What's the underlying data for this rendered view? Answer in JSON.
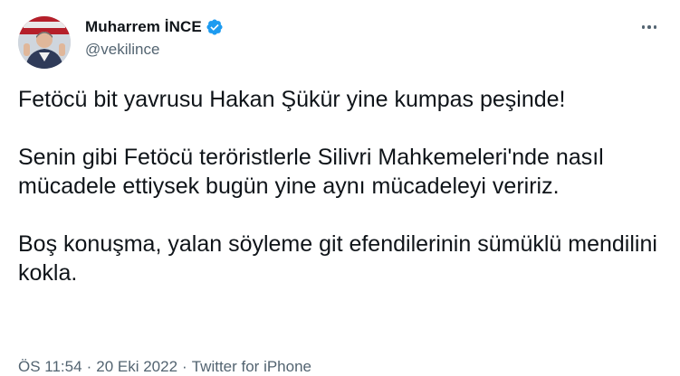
{
  "author": {
    "display_name": "Muharrem İNCE",
    "handle": "@vekilince",
    "verified": true,
    "verified_icon": "verified-badge-icon",
    "avatar_icon": "profile-photo"
  },
  "tweet": {
    "paragraphs": [
      "Fetöcü bit yavrusu Hakan Şükür yine kumpas peşinde!",
      "Senin gibi Fetöcü teröristlerle Silivri Mahkemeleri'nde nasıl mücadele ettiysek bugün yine aynı mücadeleyi veririz.",
      "Boş konuşma, yalan söyleme git efendilerinin sümüklü mendilini kokla."
    ]
  },
  "meta": {
    "time": "ÖS 11:54",
    "separator": "·",
    "date": "20 Eki 2022",
    "source": "Twitter for iPhone"
  },
  "menu": {
    "more_icon": "more-options-icon"
  },
  "colors": {
    "text": "#0f1419",
    "secondary": "#536471",
    "verified_blue": "#1d9bf0",
    "background": "#ffffff"
  }
}
